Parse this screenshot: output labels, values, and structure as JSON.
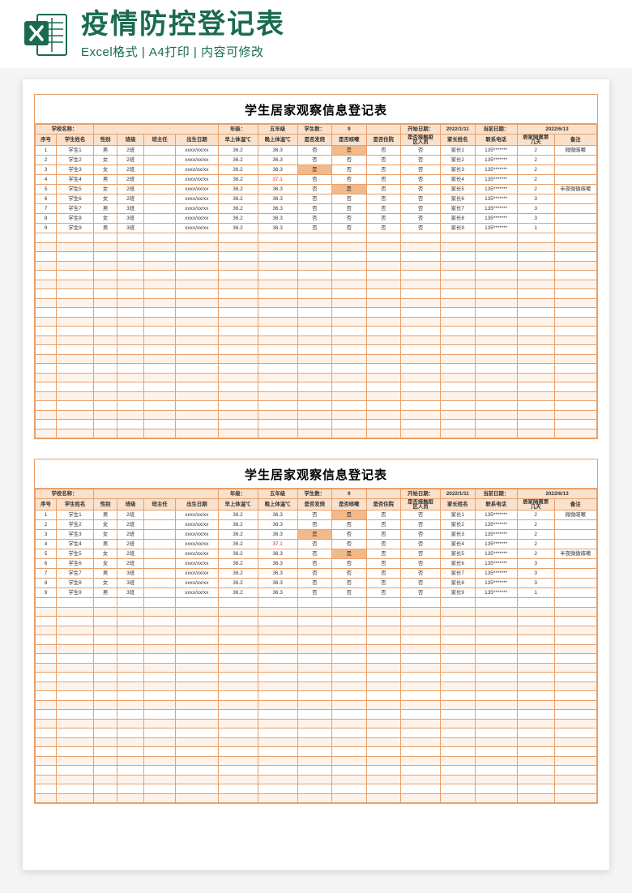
{
  "header": {
    "title": "疫情防控登记表",
    "subtitle": "Excel格式 | A4打印 | 内容可修改"
  },
  "sheet": {
    "title": "学生居家观察信息登记表",
    "info_labels": {
      "school": "学校名称：",
      "grade": "年级：",
      "grade_val": "五年级",
      "count": "学生数：",
      "count_val": "9",
      "start": "开始日期：",
      "start_val": "2022/1/11",
      "today": "当前日期：",
      "today_val": "2022/6/13"
    },
    "columns": [
      "序号",
      "学生姓名",
      "性别",
      "班级",
      "班主任",
      "出生日期",
      "早上体温℃",
      "晚上体温℃",
      "是否发烧",
      "是否咳嗽",
      "是否住院",
      "是否接触疫区人员",
      "家长姓名",
      "联系电话",
      "居家隔离第几天",
      "备注"
    ],
    "rows": [
      {
        "n": "1",
        "name": "学生1",
        "sex": "男",
        "cls": "2班",
        "t": "",
        "dob": "xxxx/xx/xx",
        "m": "36.2",
        "e": "36.3",
        "fever": "否",
        "cough": "是",
        "hosp": "否",
        "ct": "否",
        "p": "家长1",
        "ph": "135*******",
        "d": "2",
        "r": "微微咳嗽",
        "cough_hl": true
      },
      {
        "n": "2",
        "name": "学生2",
        "sex": "女",
        "cls": "2班",
        "t": "",
        "dob": "xxxx/xx/xx",
        "m": "36.2",
        "e": "36.3",
        "fever": "否",
        "cough": "否",
        "hosp": "否",
        "ct": "否",
        "p": "家长2",
        "ph": "135*******",
        "d": "2",
        "r": ""
      },
      {
        "n": "3",
        "name": "学生3",
        "sex": "女",
        "cls": "2班",
        "t": "",
        "dob": "xxxx/xx/xx",
        "m": "36.2",
        "e": "36.3",
        "fever": "是",
        "cough": "否",
        "hosp": "否",
        "ct": "否",
        "p": "家长3",
        "ph": "135*******",
        "d": "2",
        "r": "",
        "fever_hl": true
      },
      {
        "n": "4",
        "name": "学生4",
        "sex": "男",
        "cls": "2班",
        "t": "",
        "dob": "xxxx/xx/xx",
        "m": "36.2",
        "e": "37.1",
        "fever": "否",
        "cough": "否",
        "hosp": "否",
        "ct": "否",
        "p": "家长4",
        "ph": "135*******",
        "d": "2",
        "r": "",
        "e_hot": true
      },
      {
        "n": "5",
        "name": "学生5",
        "sex": "女",
        "cls": "2班",
        "t": "",
        "dob": "xxxx/xx/xx",
        "m": "36.2",
        "e": "36.3",
        "fever": "否",
        "cough": "是",
        "hosp": "否",
        "ct": "否",
        "p": "家长5",
        "ph": "135*******",
        "d": "2",
        "r": "半夜微微咳嗽",
        "cough_hl": true
      },
      {
        "n": "6",
        "name": "学生6",
        "sex": "女",
        "cls": "2班",
        "t": "",
        "dob": "xxxx/xx/xx",
        "m": "36.2",
        "e": "36.3",
        "fever": "否",
        "cough": "否",
        "hosp": "否",
        "ct": "否",
        "p": "家长6",
        "ph": "135*******",
        "d": "3",
        "r": ""
      },
      {
        "n": "7",
        "name": "学生7",
        "sex": "男",
        "cls": "3班",
        "t": "",
        "dob": "xxxx/xx/xx",
        "m": "36.2",
        "e": "36.3",
        "fever": "否",
        "cough": "否",
        "hosp": "否",
        "ct": "否",
        "p": "家长7",
        "ph": "135*******",
        "d": "3",
        "r": ""
      },
      {
        "n": "8",
        "name": "学生8",
        "sex": "女",
        "cls": "3班",
        "t": "",
        "dob": "xxxx/xx/xx",
        "m": "36.2",
        "e": "36.3",
        "fever": "否",
        "cough": "否",
        "hosp": "否",
        "ct": "否",
        "p": "家长8",
        "ph": "135*******",
        "d": "3",
        "r": ""
      },
      {
        "n": "9",
        "name": "学生9",
        "sex": "男",
        "cls": "3班",
        "t": "",
        "dob": "xxxx/xx/xx",
        "m": "36.2",
        "e": "36.3",
        "fever": "否",
        "cough": "否",
        "hosp": "否",
        "ct": "否",
        "p": "家长9",
        "ph": "135*******",
        "d": "1",
        "r": ""
      }
    ],
    "blank_rows": 22
  }
}
